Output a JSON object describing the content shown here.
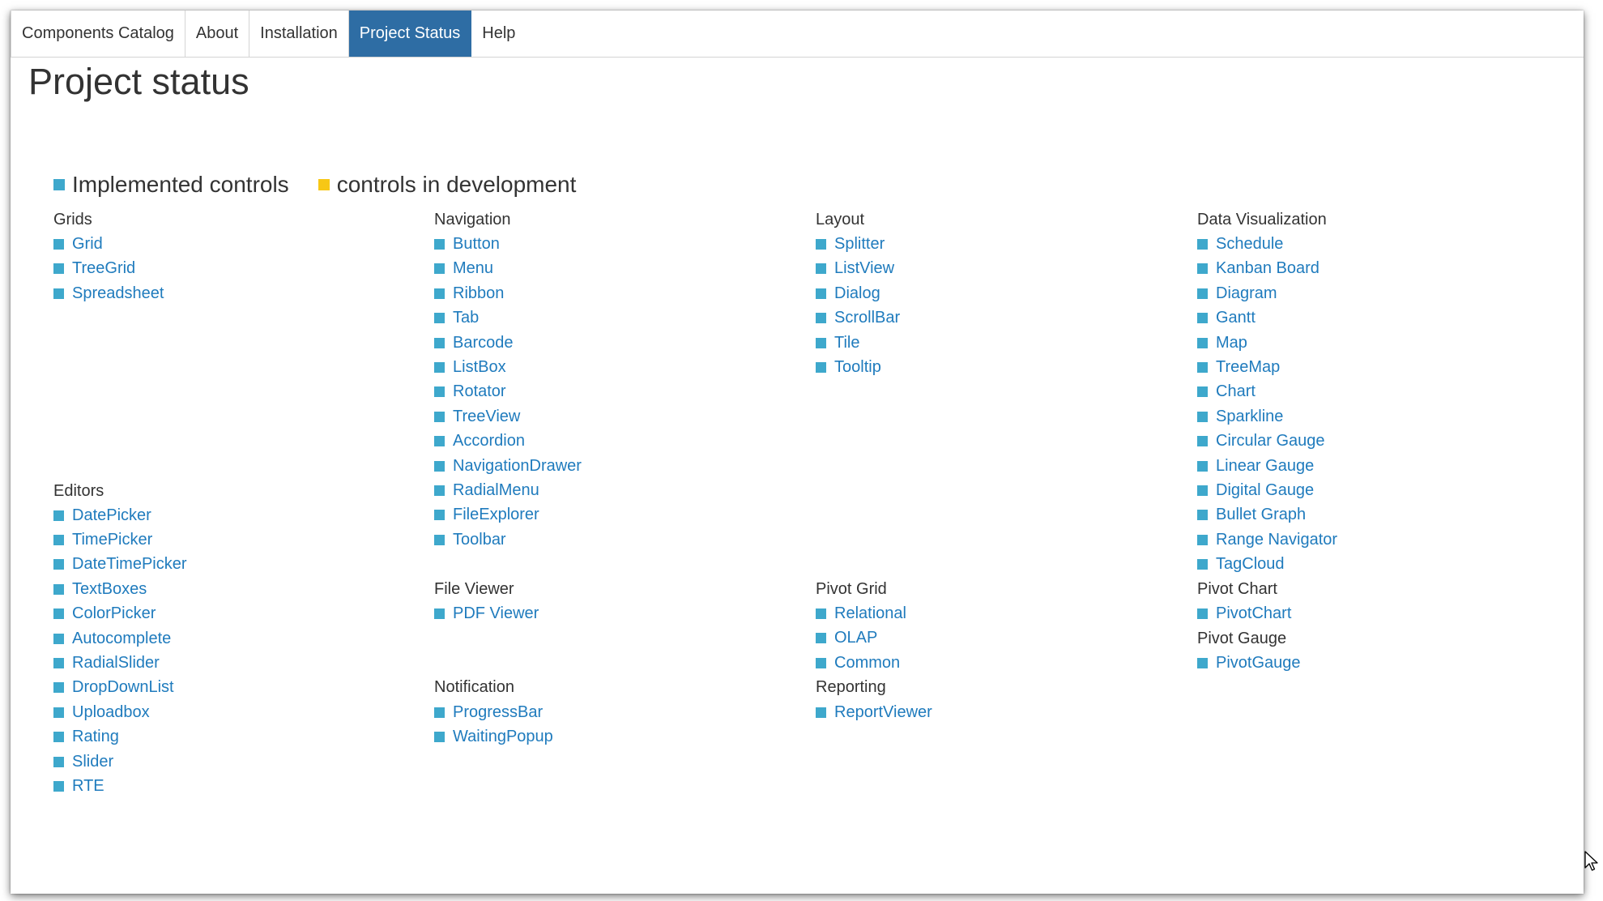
{
  "colors": {
    "implemented": "#3ea8cc",
    "in_development": "#f7c716",
    "link": "#1f7bbd",
    "active_tab": "#2e6da4"
  },
  "nav": {
    "tabs": [
      {
        "label": "Components Catalog",
        "active": false
      },
      {
        "label": "About",
        "active": false
      },
      {
        "label": "Installation",
        "active": false
      },
      {
        "label": "Project Status",
        "active": true
      },
      {
        "label": "Help",
        "active": false
      }
    ]
  },
  "page": {
    "title": "Project status"
  },
  "legend": {
    "implemented": "Implemented controls",
    "in_development": "controls in development"
  },
  "groups": {
    "grids": {
      "title": "Grids",
      "items": [
        "Grid",
        "TreeGrid",
        "Spreadsheet"
      ]
    },
    "navigation": {
      "title": "Navigation",
      "items": [
        "Button",
        "Menu",
        "Ribbon",
        "Tab",
        "Barcode",
        "ListBox",
        "Rotator",
        "TreeView",
        "Accordion",
        "NavigationDrawer",
        "RadialMenu",
        "FileExplorer",
        "Toolbar"
      ]
    },
    "layout": {
      "title": "Layout",
      "items": [
        "Splitter",
        "ListView",
        "Dialog",
        "ScrollBar",
        "Tile",
        "Tooltip"
      ]
    },
    "data_visualization": {
      "title": "Data Visualization",
      "items": [
        "Schedule",
        "Kanban Board",
        "Diagram",
        "Gantt",
        "Map",
        "TreeMap",
        "Chart",
        "Sparkline",
        "Circular Gauge",
        "Linear Gauge",
        "Digital Gauge",
        "Bullet Graph",
        "Range Navigator",
        "TagCloud"
      ]
    },
    "editors": {
      "title": "Editors",
      "items": [
        "DatePicker",
        "TimePicker",
        "DateTimePicker",
        "TextBoxes",
        "ColorPicker",
        "Autocomplete",
        "RadialSlider",
        "DropDownList",
        "Uploadbox",
        "Rating",
        "Slider",
        "RTE"
      ]
    },
    "file_viewer": {
      "title": "File Viewer",
      "items": [
        "PDF Viewer"
      ]
    },
    "notification": {
      "title": "Notification",
      "items": [
        "ProgressBar",
        "WaitingPopup"
      ]
    },
    "pivot_grid": {
      "title": "Pivot Grid",
      "items": [
        "Relational",
        "OLAP",
        "Common"
      ]
    },
    "reporting": {
      "title": "Reporting",
      "items": [
        "ReportViewer"
      ]
    },
    "pivot_chart": {
      "title": "Pivot Chart",
      "items": [
        "PivotChart"
      ]
    },
    "pivot_gauge": {
      "title": "Pivot Gauge",
      "items": [
        "PivotGauge"
      ]
    }
  }
}
